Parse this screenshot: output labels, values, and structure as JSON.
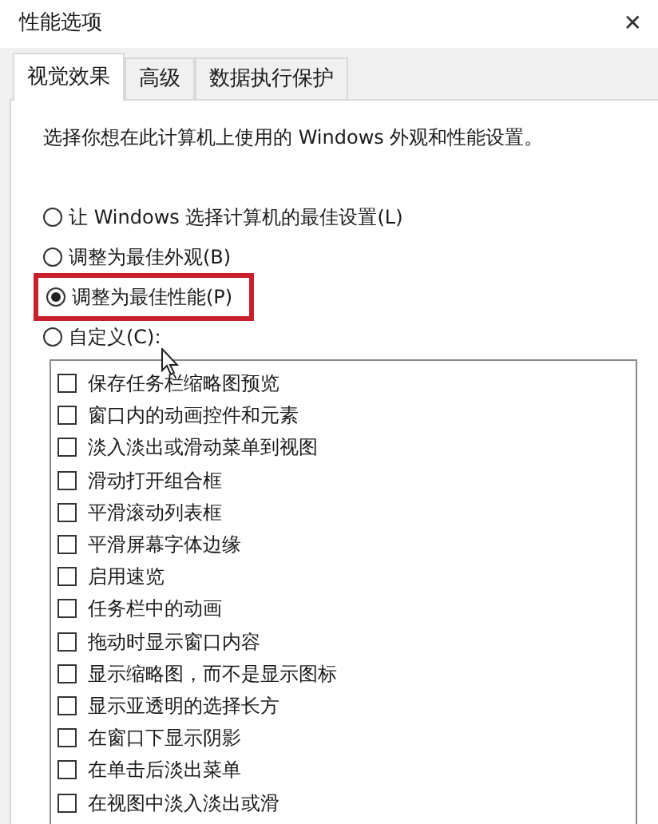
{
  "window": {
    "title": "性能选项",
    "close": "✕"
  },
  "tabs": [
    {
      "label": "视觉效果",
      "selected": true
    },
    {
      "label": "高级",
      "selected": false
    },
    {
      "label": "数据执行保护",
      "selected": false
    }
  ],
  "description": "选择你想在此计算机上使用的 Windows 外观和性能设置。",
  "options": [
    {
      "label": "让 Windows 选择计算机的最佳设置(L)",
      "selected": false,
      "highlighted": false
    },
    {
      "label": "调整为最佳外观(B)",
      "selected": false,
      "highlighted": false
    },
    {
      "label": "调整为最佳性能(P)",
      "selected": true,
      "highlighted": true
    },
    {
      "label": "自定义(C):",
      "selected": false,
      "highlighted": false
    }
  ],
  "effects": [
    {
      "label": "保存任务栏缩略图预览",
      "checked": false
    },
    {
      "label": "窗口内的动画控件和元素",
      "checked": false
    },
    {
      "label": "淡入淡出或滑动菜单到视图",
      "checked": false
    },
    {
      "label": "滑动打开组合框",
      "checked": false
    },
    {
      "label": "平滑滚动列表框",
      "checked": false
    },
    {
      "label": "平滑屏幕字体边缘",
      "checked": false
    },
    {
      "label": "启用速览",
      "checked": false
    },
    {
      "label": "任务栏中的动画",
      "checked": false
    },
    {
      "label": "拖动时显示窗口内容",
      "checked": false
    },
    {
      "label": "显示缩略图，而不是显示图标",
      "checked": false
    },
    {
      "label": "显示亚透明的选择长方",
      "checked": false
    },
    {
      "label": "在窗口下显示阴影",
      "checked": false
    },
    {
      "label": "在单击后淡出菜单",
      "checked": false
    },
    {
      "label": "在视图中淡入淡出或滑",
      "checked": false
    }
  ]
}
